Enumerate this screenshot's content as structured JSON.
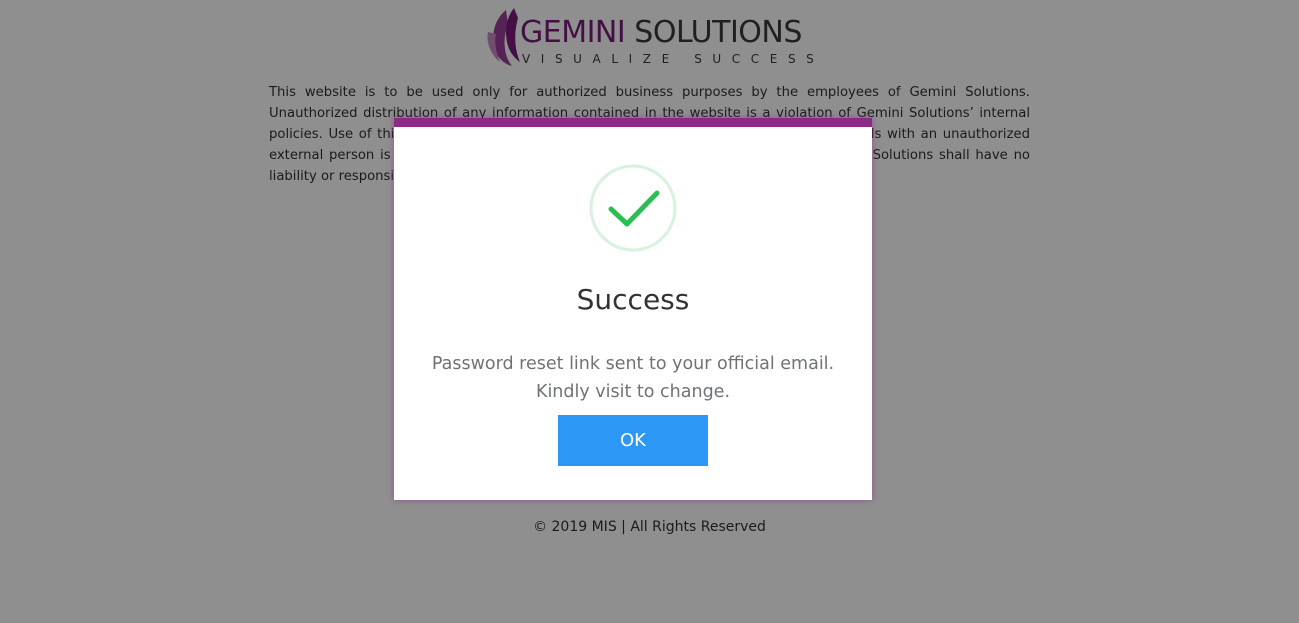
{
  "header": {
    "logo_word_primary": "GEMINI",
    "logo_word_secondary": "SOLUTIONS",
    "logo_tagline": "VISUALIZE SUCCESS"
  },
  "disclaimer": {
    "text": "This website is to be used only for authorized business purposes by the employees of Gemini Solutions. Unauthorized distribution of any information contained in the website is a violation of Gemini Solutions’ internal policies. Use of this website by an unauthorized person or sharing of the login credentials with an unauthorized external person is a violation and may lead to legal action by Gemini Solutions. Gemini Solutions shall have no liability or responsibility for any loss arising from unauthorized use of the website."
  },
  "footer": {
    "text": "© 2019 MIS | All Rights Reserved"
  },
  "modal": {
    "icon": "check-icon",
    "title": "Success",
    "message_line1": "Password reset link sent to your official email.",
    "message_line2": "Kindly visit to change.",
    "ok_label": "OK",
    "accent_color": "#8c2a86",
    "button_color": "#2d97f6",
    "check_color": "#2bbf53"
  }
}
